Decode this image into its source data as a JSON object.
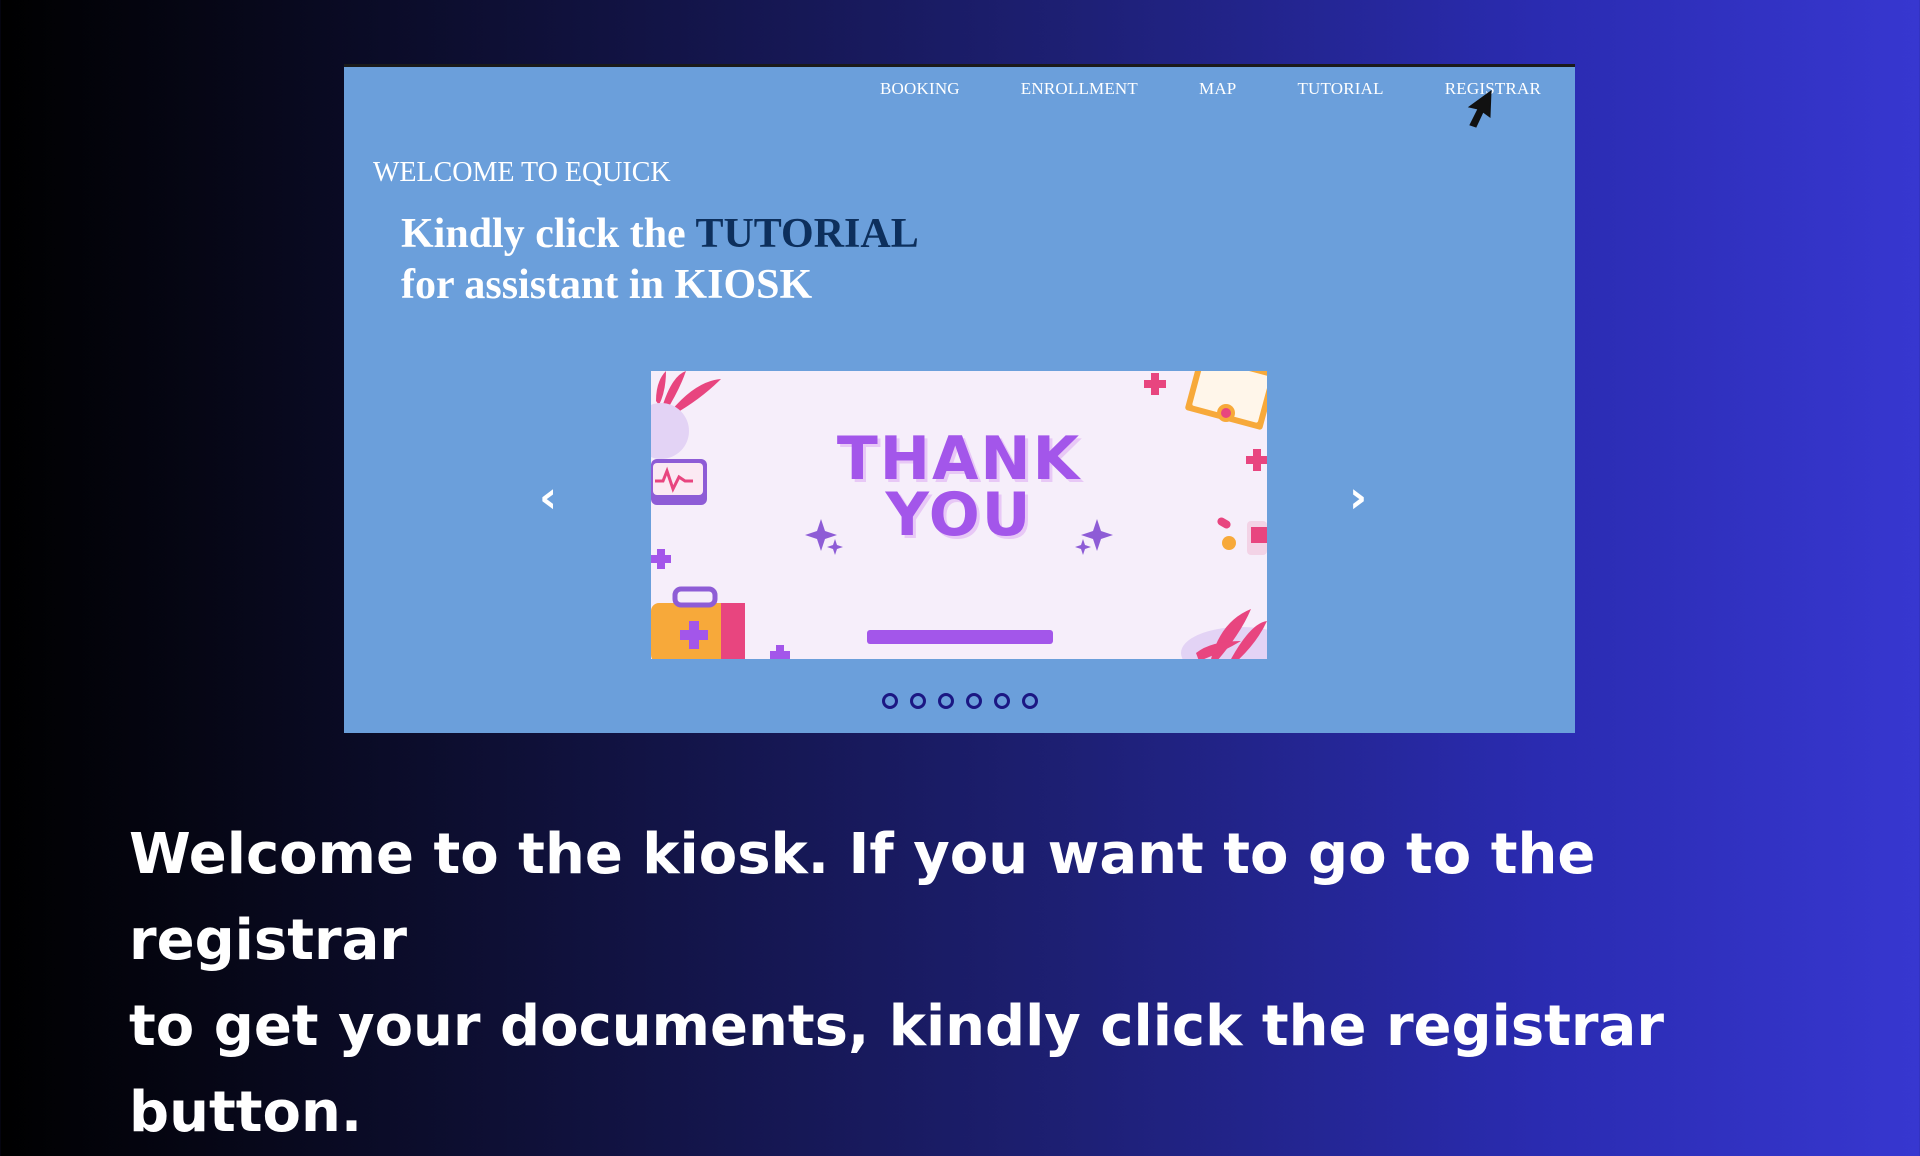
{
  "nav": {
    "items": [
      "BOOKING",
      "ENROLLMENT",
      "MAP",
      "TUTORIAL",
      "REGISTRAR"
    ]
  },
  "hero": {
    "welcome": "WELCOME TO EQUICK",
    "line1_pre": "Kindly click the ",
    "line1_accent": "TUTORIAL",
    "line2": "for assistant in KIOSK"
  },
  "carousel": {
    "slide_title_line1": "THANK",
    "slide_title_line2": "YOU",
    "prev_label": "‹",
    "next_label": "›",
    "dot_count": 6
  },
  "caption": {
    "line1": "Welcome to the kiosk. If you want to go to the registrar",
    "line2": "to get your documents, kindly click the registrar button."
  },
  "colors": {
    "screen_bg": "#6b9fdb",
    "accent_text": "#0d2f5c",
    "slide_purple": "#a356ea",
    "dot_color": "#1b1783"
  }
}
